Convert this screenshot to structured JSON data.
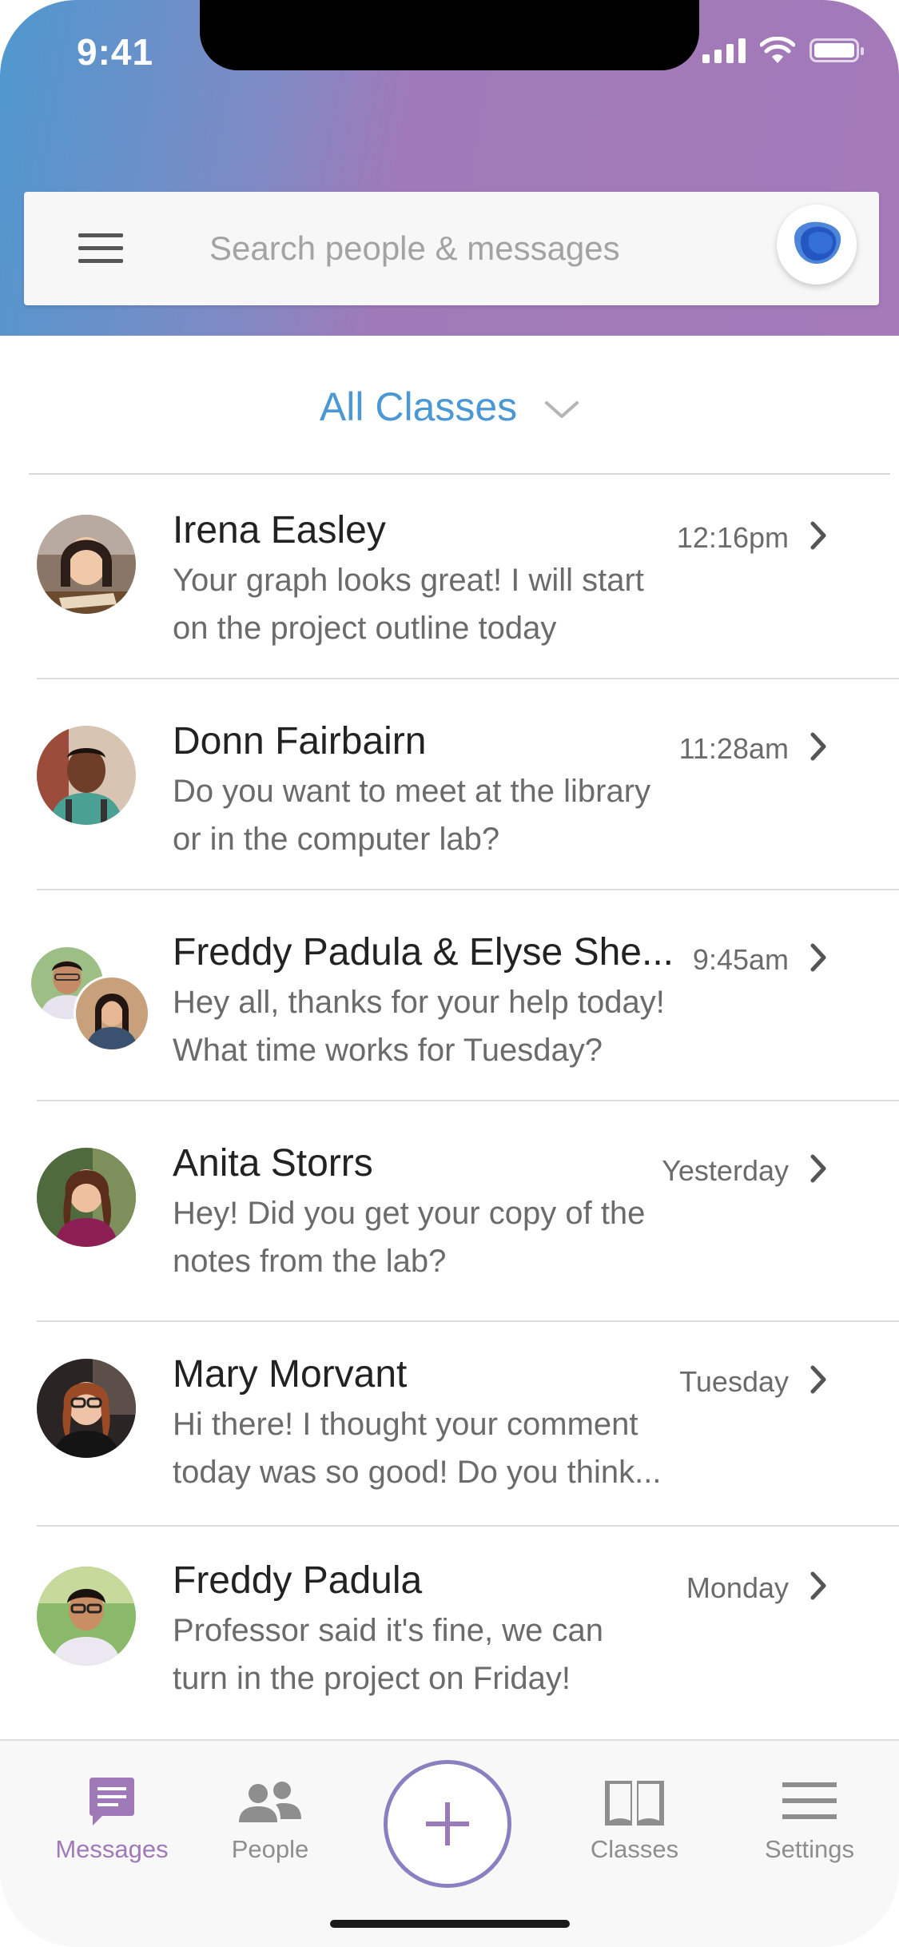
{
  "status_bar": {
    "time": "9:41"
  },
  "search": {
    "placeholder": "Search people & messages"
  },
  "filter": {
    "label": "All Classes"
  },
  "messages": [
    {
      "name": "Irena Easley",
      "time": "12:16pm",
      "preview_line1": "Your graph looks great! I will start",
      "preview_line2": "on the project outline today"
    },
    {
      "name": "Donn Fairbairn",
      "time": "11:28am",
      "preview_line1": "Do you want to meet at the library",
      "preview_line2": "or in the computer lab?"
    },
    {
      "name": "Freddy Padula & Elyse She...",
      "time": "9:45am",
      "preview_line1": "Hey all, thanks for your help today!",
      "preview_line2": "What time works for Tuesday?"
    },
    {
      "name": "Anita Storrs",
      "time": "Yesterday",
      "preview_line1": "Hey! Did you get your copy of the",
      "preview_line2": "notes from the lab?"
    },
    {
      "name": "Mary Morvant",
      "time": "Tuesday",
      "preview_line1": "Hi there! I thought your comment",
      "preview_line2": "today was so good! Do you think..."
    },
    {
      "name": "Freddy Padula",
      "time": "Monday",
      "preview_line1": "Professor said it's fine, we can",
      "preview_line2": "turn in the project on Friday!"
    }
  ],
  "tabbar": {
    "messages": "Messages",
    "people": "People",
    "classes": "Classes",
    "settings": "Settings"
  },
  "colors": {
    "accent_purple": "#a07ab8",
    "accent_blue": "#4b98d4",
    "header_gradient_start": "#4f98cf",
    "header_gradient_end": "#a47ab9"
  },
  "icons": {
    "menu": "hamburger-menu-icon",
    "assistant": "assistant-blob-icon",
    "filter_chevron": "chevron-down-icon",
    "row_arrow": "chevron-right-icon",
    "messages_tab": "chat-bubble-icon",
    "people_tab": "people-icon",
    "compose": "plus-icon",
    "classes_tab": "open-book-icon",
    "settings_tab": "settings-lines-icon"
  }
}
